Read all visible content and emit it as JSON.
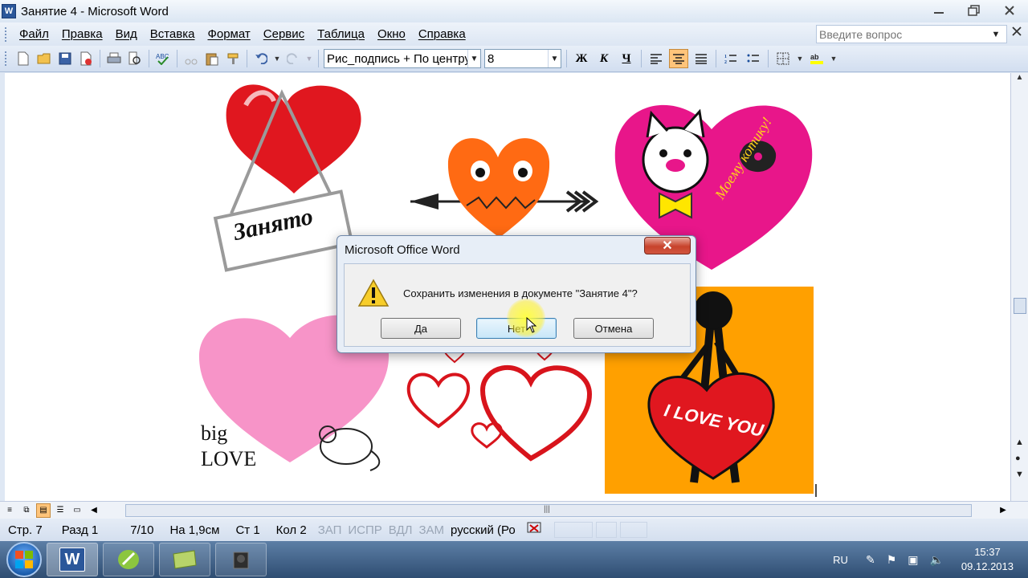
{
  "window": {
    "title": "Занятие 4 - Microsoft Word",
    "app_icon": "W",
    "minimize_icon": "minimize-icon",
    "restore_icon": "restore-icon",
    "close_icon": "close-icon"
  },
  "menu": {
    "items": [
      "Файл",
      "Правка",
      "Вид",
      "Вставка",
      "Формат",
      "Сервис",
      "Таблица",
      "Окно",
      "Справка"
    ],
    "help_placeholder": "Введите вопрос"
  },
  "toolbar": {
    "style_value": "Рис_подпись + По центру",
    "size_value": "8",
    "bold_label": "Ж",
    "italic_label": "К",
    "underline_label": "Ч",
    "alignment_selected": "center"
  },
  "document": {
    "images": [
      {
        "name": "heart-sign-zanyato",
        "text": "Занято"
      },
      {
        "name": "heart-arrow"
      },
      {
        "name": "heart-kitty",
        "text": "Моему котику!"
      },
      {
        "name": "heart-big-love",
        "text_line1": "big",
        "text_line2": "LOVE"
      },
      {
        "name": "heart-outlines"
      },
      {
        "name": "heart-i-love-you",
        "text": "I LOVE YOU"
      }
    ]
  },
  "dialog": {
    "title": "Microsoft Office Word",
    "close_label": "✕",
    "message": "Сохранить изменения в документе \"Занятие 4\"?",
    "buttons": {
      "yes": "Да",
      "no": "Нет",
      "cancel": "Отмена"
    }
  },
  "status": {
    "page": "Стр. 7",
    "section": "Разд 1",
    "pages": "7/10",
    "position": "На 1,9см",
    "line": "Ст 1",
    "column": "Кол 2",
    "rec": "ЗАП",
    "trk": "ИСПР",
    "ext": "ВДЛ",
    "ovr": "ЗАМ",
    "language": "русский (Ро"
  },
  "taskbar": {
    "apps": [
      "word",
      "corel",
      "envelope",
      "camera"
    ],
    "word_label": "W",
    "tray_lang": "RU",
    "time": "15:37",
    "date": "09.12.2013"
  },
  "colors": {
    "heart_red": "#e0171f",
    "heart_orange": "#ff6a13",
    "heart_magenta": "#e8168a",
    "heart_pink": "#f794c8",
    "orange_panel": "#ffa000",
    "word_blue": "#2b579a",
    "active_format": "#ffc47a"
  }
}
